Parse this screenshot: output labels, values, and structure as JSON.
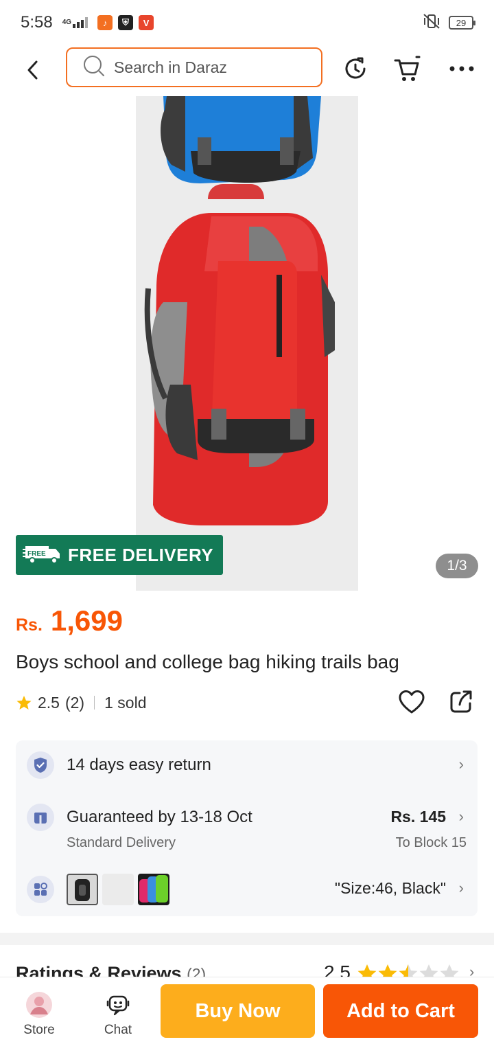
{
  "status_bar": {
    "time": "5:58",
    "network": "4G",
    "battery": "29"
  },
  "nav": {
    "search_placeholder": "Search in Daraz"
  },
  "gallery": {
    "free_delivery_label": "FREE DELIVERY",
    "free_badge_text": "FREE",
    "page_indicator": "1/3"
  },
  "product": {
    "currency": "Rs.",
    "price": "1,699",
    "title": "Boys school and college bag hiking trails bag",
    "rating": "2.5",
    "rating_count": "(2)",
    "sold": "1 sold"
  },
  "info": {
    "return_policy": "14 days easy return",
    "delivery_guarantee": "Guaranteed by 13-18 Oct",
    "delivery_type": "Standard Delivery",
    "delivery_fee": "Rs. 145",
    "delivery_location": "To Block 15",
    "variant_selected": "\"Size:46, Black\""
  },
  "reviews": {
    "title": "Ratings & Reviews",
    "count": "(2)",
    "score": "2.5",
    "stars": 2.5
  },
  "bottom_bar": {
    "store_label": "Store",
    "chat_label": "Chat",
    "buy_now_label": "Buy Now",
    "add_to_cart_label": "Add to Cart"
  },
  "colors": {
    "brand_orange": "#f85606",
    "buy_yellow": "#fdad1c",
    "free_delivery_green": "#137a56"
  }
}
